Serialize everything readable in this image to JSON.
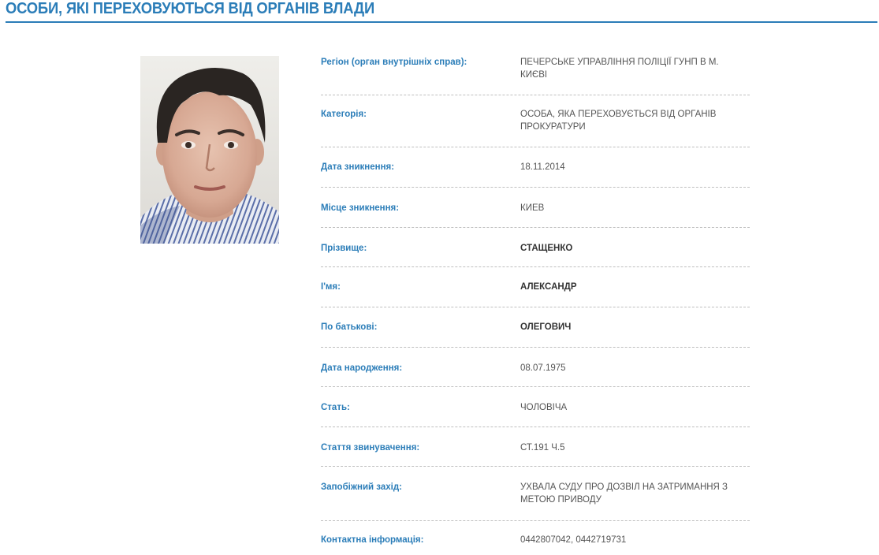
{
  "header": {
    "title": "ОСОБИ, ЯКІ ПЕРЕХОВУЮТЬСЯ ВІД ОРГАНІВ ВЛАДИ"
  },
  "photo": {
    "alt": "Фото особи"
  },
  "details": [
    {
      "label": "Регіон (орган внутрішніх справ):",
      "value": "ПЕЧЕРСЬКЕ УПРАВЛІННЯ ПОЛІЦІЇ ГУНП В М. КИЄВІ"
    },
    {
      "label": "Категорія:",
      "value": "ОСОБА, ЯКА ПЕРЕХОВУЄТЬСЯ ВІД ОРГАНІВ ПРОКУРАТУРИ"
    },
    {
      "label": "Дата зникнення:",
      "value": "18.11.2014"
    },
    {
      "label": "Місце зникнення:",
      "value": "КИЕВ"
    },
    {
      "label": "Прізвище:",
      "value": "СТАЩЕНКО"
    },
    {
      "label": "І'мя:",
      "value": "АЛЕКСАНДР"
    },
    {
      "label": "По батькові:",
      "value": "ОЛЕГОВИЧ"
    },
    {
      "label": "Дата народження:",
      "value": "08.07.1975"
    },
    {
      "label": "Стать:",
      "value": "ЧОЛОВІЧА"
    },
    {
      "label": "Стаття звинувачення:",
      "value": "СТ.191 Ч.5"
    },
    {
      "label": "Запобіжний захід:",
      "value": "УХВАЛА СУДУ ПРО ДОЗВІЛ НА ЗАТРИМАННЯ З МЕТОЮ ПРИВОДУ"
    },
    {
      "label": "Контактна інформація:",
      "value": "0442807042, 0442719731"
    }
  ]
}
